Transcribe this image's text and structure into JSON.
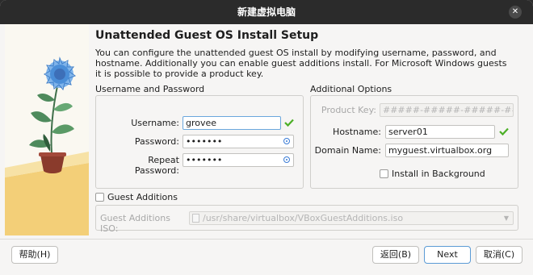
{
  "window": {
    "title": "新建虚拟电脑",
    "close_glyph": "✕"
  },
  "page": {
    "heading": "Unattended Guest OS Install Setup",
    "description_lines": [
      "You can configure the unattended guest OS install by modifying username, password, and",
      "hostname. Additionally you can enable guest additions install. For Microsoft Windows guests",
      "it is possible to provide a product key."
    ]
  },
  "credentials": {
    "section_label": "Username and Password",
    "username_label": "Username:",
    "username_value": "grovee",
    "password_label": "Password:",
    "password_value": "•••••••",
    "repeat_label": "Repeat Password:",
    "repeat_value": "•••••••"
  },
  "options": {
    "section_label": "Additional Options",
    "product_key_label": "Product Key:",
    "product_key_placeholder": "#####-#####-#####-#####-#####",
    "hostname_label": "Hostname:",
    "hostname_value": "server01",
    "domain_label": "Domain Name:",
    "domain_value": "myguest.virtualbox.org",
    "background_label": "Install in Background",
    "background_checked": false
  },
  "guest_additions": {
    "checkbox_label": "Guest Additions",
    "checked": false,
    "iso_label": "Guest Additions ISO:",
    "iso_path": "/usr/share/virtualbox/VBoxGuestAdditions.iso"
  },
  "buttons": {
    "help": "帮助(H)",
    "back": "返回(B)",
    "next": "Next",
    "cancel": "取消(C)"
  },
  "colors": {
    "ok_check": "#4caf27",
    "accent": "#5b9bd5"
  }
}
